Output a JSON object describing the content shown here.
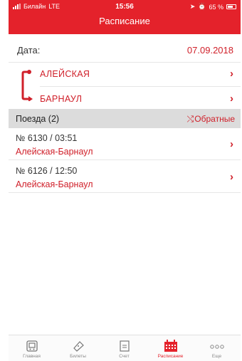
{
  "status_bar": {
    "carrier": "Билайн",
    "network": "LTE",
    "time": "15:56",
    "battery": "65 %"
  },
  "header": {
    "title": "Расписание"
  },
  "date": {
    "label": "Дата:",
    "value": "07.09.2018"
  },
  "route": {
    "from": "АЛЕЙСКАЯ",
    "to": "БАРНАУЛ"
  },
  "trains_section": {
    "label": "Поезда (2)",
    "reverse_label": "Обратные"
  },
  "trains": [
    {
      "number": "№ 6130 / 03:51",
      "direction": "Алейская-Барнаул"
    },
    {
      "number": "№ 6126 / 12:50",
      "direction": "Алейская-Барнаул"
    }
  ],
  "tabs": [
    {
      "label": "Главная",
      "icon": "home-icon"
    },
    {
      "label": "Билеты",
      "icon": "ticket-icon"
    },
    {
      "label": "Счет",
      "icon": "receipt-icon"
    },
    {
      "label": "Расписание",
      "icon": "calendar-icon",
      "active": true
    },
    {
      "label": "Еще",
      "icon": "more-icon"
    }
  ],
  "colors": {
    "accent": "#e4222b",
    "section_bg": "#dcdcdc"
  }
}
